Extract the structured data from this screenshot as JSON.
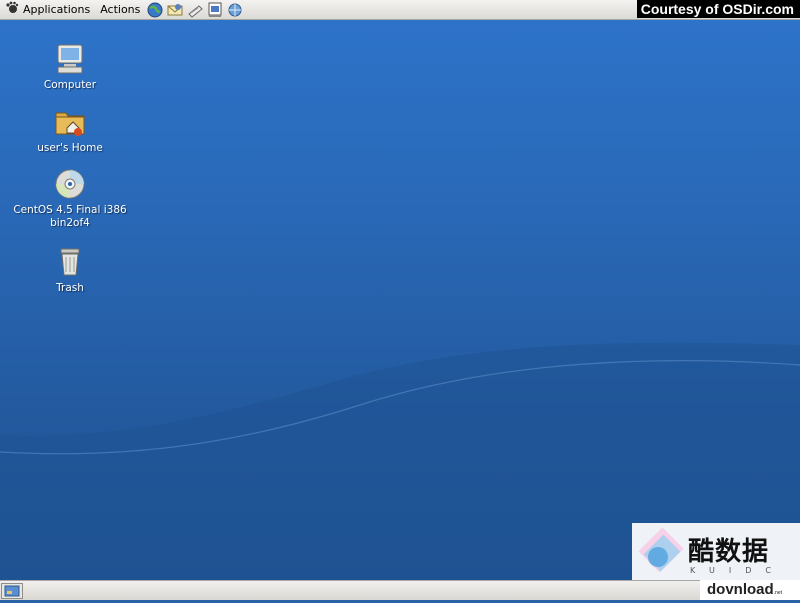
{
  "top_panel": {
    "applications_label": "Applications",
    "actions_label": "Actions",
    "launchers": [
      "web-browser-icon",
      "email-icon",
      "text-editor-icon",
      "presentation-icon",
      "network-icon"
    ]
  },
  "watermark": {
    "courtesy": "Courtesy of OSDir.com",
    "site_name": "酷数据",
    "site_sub": "KUIDC",
    "download": "dovnload",
    "download_suffix": ".net"
  },
  "desktop_icons": [
    {
      "label": "Computer",
      "icon": "computer-icon"
    },
    {
      "label": "user's Home",
      "icon": "home-folder-icon"
    },
    {
      "label": "CentOS 4.5 Final i386 bin2of4",
      "icon": "cd-icon"
    },
    {
      "label": "Trash",
      "icon": "trash-icon"
    }
  ],
  "colors": {
    "desktop_blue": "#2a66b3",
    "panel": "#dcdad5"
  }
}
